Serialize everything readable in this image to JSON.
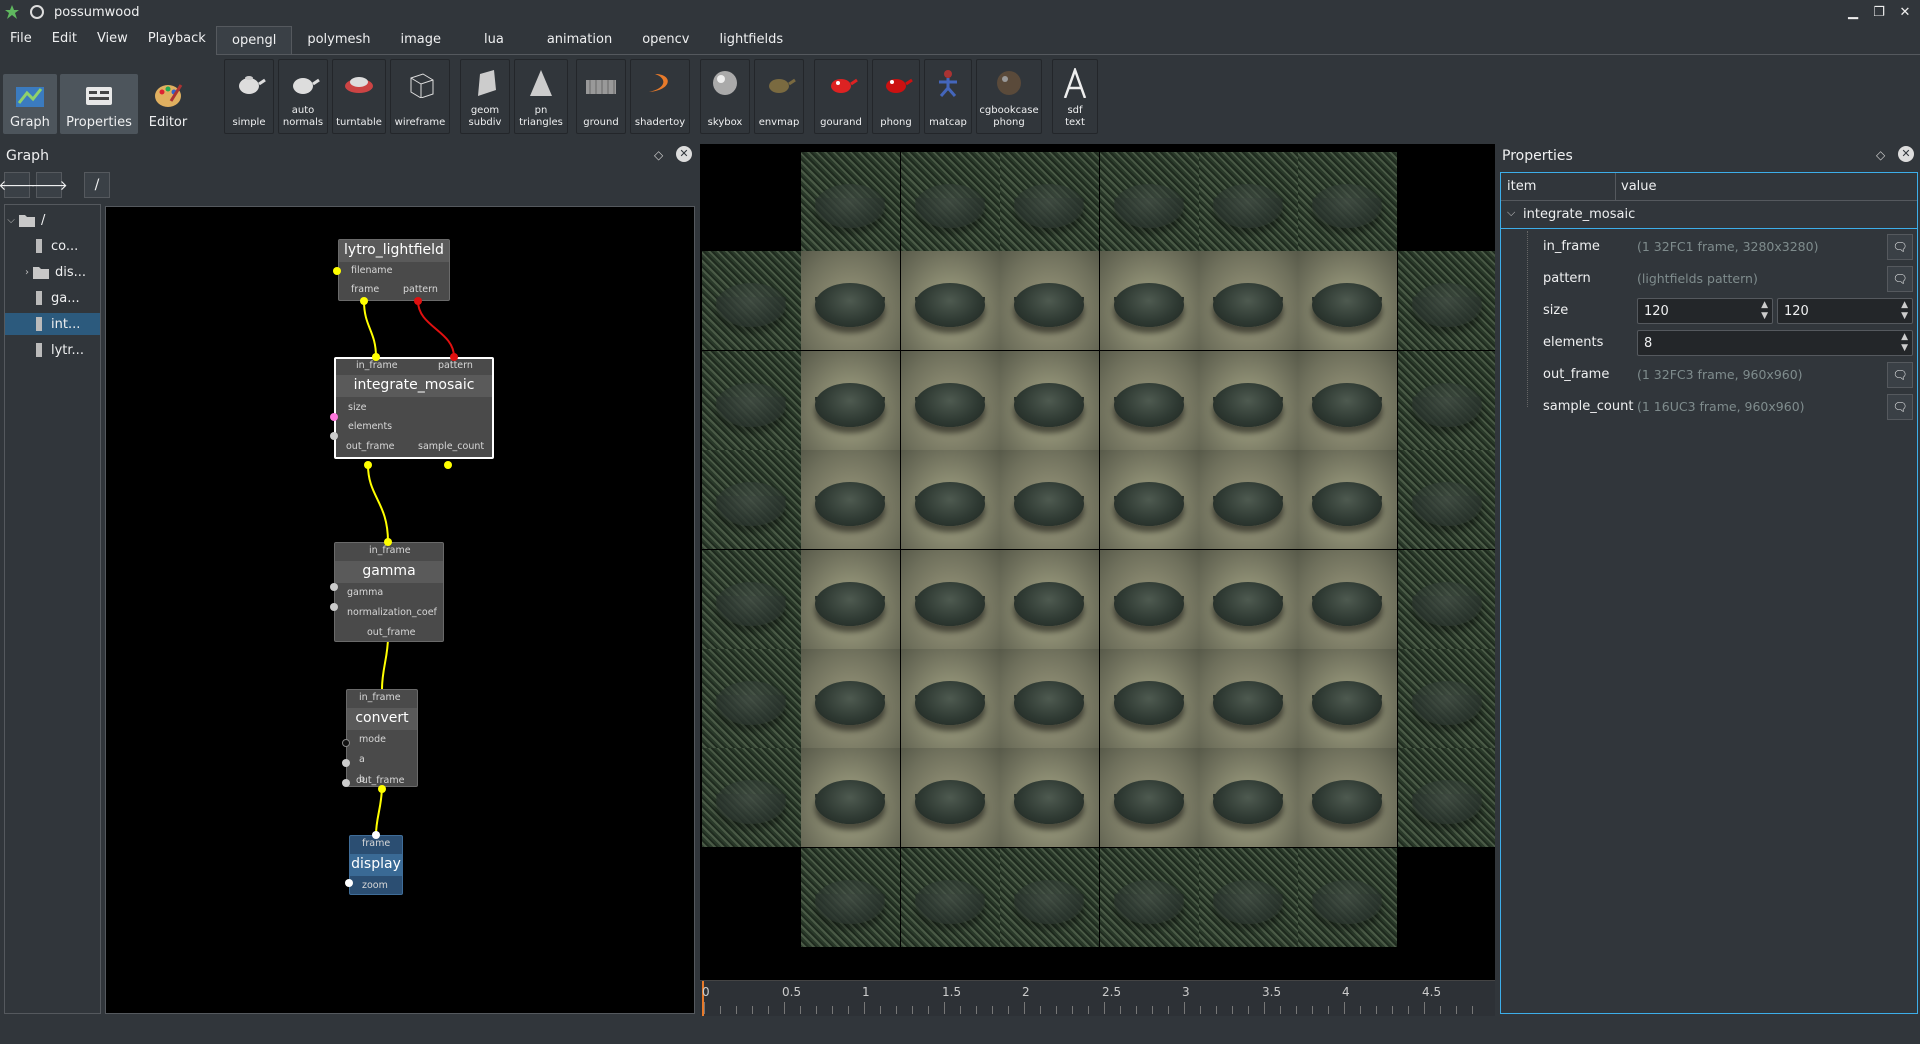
{
  "window": {
    "title": "possumwood"
  },
  "menu": [
    "File",
    "Edit",
    "View",
    "Playback"
  ],
  "modes": [
    {
      "label": "Graph",
      "icon": "graph-icon"
    },
    {
      "label": "Properties",
      "icon": "properties-icon"
    },
    {
      "label": "Editor",
      "icon": "palette-icon"
    }
  ],
  "tabs": [
    "opengl",
    "polymesh",
    "image",
    "lua",
    "animation",
    "opencv",
    "lightfields"
  ],
  "tools": [
    {
      "label": "simple",
      "icon": "teapot-icon"
    },
    {
      "label": "auto\nnormals",
      "icon": "teapot-icon"
    },
    {
      "label": "turntable",
      "icon": "car-icon"
    },
    {
      "label": "wireframe",
      "icon": "cube-icon"
    },
    {
      "label": "geom\nsubdiv",
      "icon": "shape-icon"
    },
    {
      "label": "pn\ntriangles",
      "icon": "cone-icon"
    },
    {
      "label": "ground",
      "icon": "grid-icon"
    },
    {
      "label": "shadertoy",
      "icon": "swirl-icon"
    },
    {
      "label": "skybox",
      "icon": "sphere-icon"
    },
    {
      "label": "envmap",
      "icon": "teapot-icon"
    },
    {
      "label": "gourand",
      "icon": "teapot-red-icon"
    },
    {
      "label": "phong",
      "icon": "teapot-red-icon"
    },
    {
      "label": "matcap",
      "icon": "figure-icon"
    },
    {
      "label": "cgbookcase\nphong",
      "icon": "sphere-icon"
    },
    {
      "label": "sdf\ntext",
      "icon": "letter-a-icon"
    }
  ],
  "graph_panel": {
    "title": "Graph",
    "path": "/",
    "tree": [
      {
        "label": "/",
        "arrow": "⌵"
      },
      {
        "label": "co..."
      },
      {
        "label": "dis...",
        "arrow": "›"
      },
      {
        "label": "ga..."
      },
      {
        "label": "int..."
      },
      {
        "label": "lytr..."
      }
    ]
  },
  "nodes": {
    "lytro": {
      "title": "lytro_lightfield",
      "ports": [
        "filename",
        "frame",
        "pattern"
      ]
    },
    "mosaic": {
      "title": "integrate_mosaic",
      "ports": [
        "in_frame",
        "pattern",
        "size",
        "elements",
        "out_frame",
        "sample_count"
      ]
    },
    "gamma": {
      "title": "gamma",
      "ports": [
        "in_frame",
        "gamma",
        "normalization_coef",
        "out_frame"
      ]
    },
    "convert": {
      "title": "convert",
      "ports": [
        "in_frame",
        "mode",
        "a",
        "b",
        "out_frame"
      ]
    },
    "display": {
      "title": "display",
      "ports": [
        "frame",
        "zoom"
      ]
    }
  },
  "timeline": {
    "labels": [
      "0",
      "0.5",
      "1",
      "1.5",
      "2",
      "2.5",
      "3",
      "3.5",
      "4",
      "4.5"
    ]
  },
  "properties_panel": {
    "title": "Properties",
    "col_item": "item",
    "col_value": "value",
    "node": "integrate_mosaic",
    "rows": {
      "in_frame": {
        "label": "in_frame",
        "value": "(1 32FC1 frame, 3280x3280)"
      },
      "pattern": {
        "label": "pattern",
        "value": "(lightfields pattern)"
      },
      "size": {
        "label": "size",
        "value_a": "120",
        "value_b": "120"
      },
      "elements": {
        "label": "elements",
        "value": "8"
      },
      "out_frame": {
        "label": "out_frame",
        "value": "(1 32FC3 frame, 960x960)"
      },
      "sample_count": {
        "label": "sample_count",
        "value": "(1 16UC3 frame, 960x960)"
      }
    }
  },
  "colors": {
    "accent": "#3daee9",
    "selection": "#2c5a7d",
    "connection": "#ffff00",
    "pattern_connection": "#e01010"
  }
}
